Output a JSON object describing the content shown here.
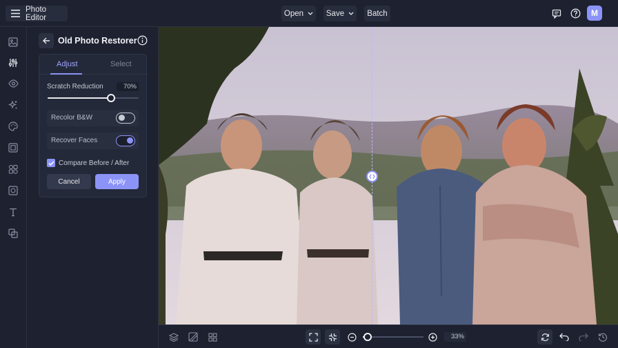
{
  "app": {
    "title": "Photo Editor",
    "menu_icon": "hamburger-menu-icon",
    "open_label": "Open",
    "save_label": "Save",
    "batch_label": "Batch",
    "user_initial": "M",
    "accent_color": "#8c93f7"
  },
  "rail": {
    "items": [
      "image-icon",
      "adjust-sliders-icon",
      "eye-icon",
      "sparkle-effects-icon",
      "palette-icon",
      "frame-icon",
      "shapes-icon",
      "crop-overlay-icon",
      "text-icon",
      "layers-graphics-icon"
    ],
    "active_index": 1
  },
  "panel": {
    "title": "Old Photo Restorer",
    "tabs": [
      {
        "label": "Adjust",
        "active": true
      },
      {
        "label": "Select",
        "active": false
      }
    ],
    "scratch_reduction": {
      "label": "Scratch Reduction",
      "value_text": "70%",
      "value": 0.7
    },
    "recolor_bw": {
      "label": "Recolor B&W",
      "on": false
    },
    "recover_faces": {
      "label": "Recover Faces",
      "on": true
    },
    "compare": {
      "label": "Compare Before / After",
      "checked": true
    },
    "cancel_label": "Cancel",
    "apply_label": "Apply"
  },
  "canvas": {
    "compare_split": 0.464
  },
  "bottom": {
    "zoom_text": "33%",
    "zoom_value": 0.33
  }
}
